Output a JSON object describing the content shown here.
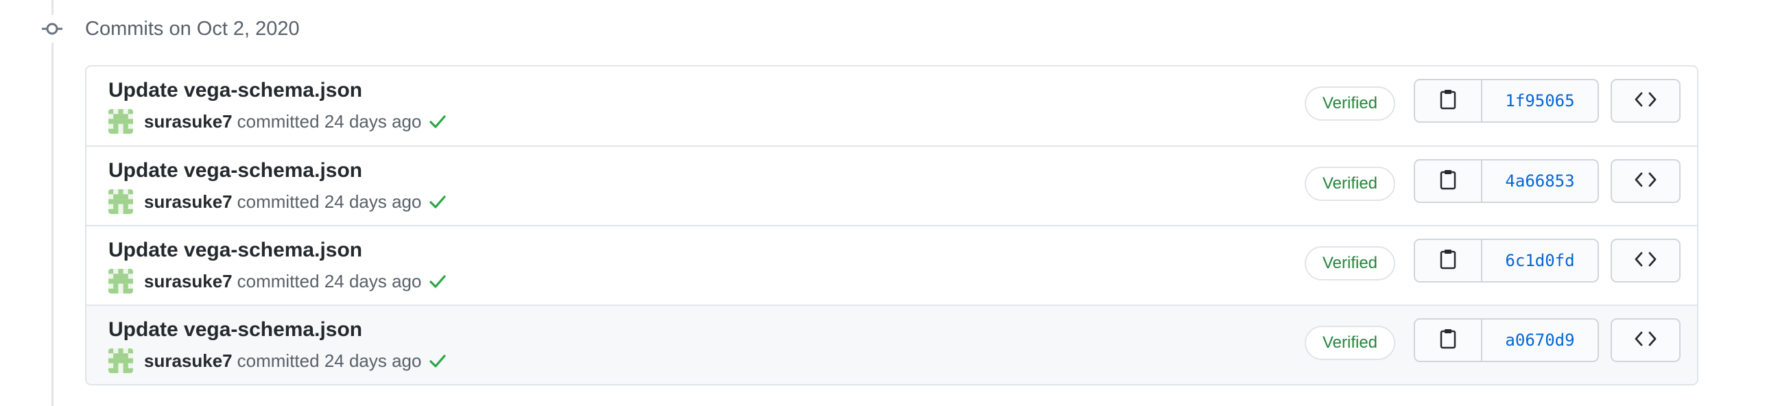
{
  "group": {
    "title": "Commits on Oct 2, 2020"
  },
  "commits": [
    {
      "title": "Update vega-schema.json",
      "author": "surasuke7",
      "action": "committed",
      "time": "24 days ago",
      "badge": "Verified",
      "sha": "1f95065"
    },
    {
      "title": "Update vega-schema.json",
      "author": "surasuke7",
      "action": "committed",
      "time": "24 days ago",
      "badge": "Verified",
      "sha": "4a66853"
    },
    {
      "title": "Update vega-schema.json",
      "author": "surasuke7",
      "action": "committed",
      "time": "24 days ago",
      "badge": "Verified",
      "sha": "6c1d0fd"
    },
    {
      "title": "Update vega-schema.json",
      "author": "surasuke7",
      "action": "committed",
      "time": "24 days ago",
      "badge": "Verified",
      "sha": "a0670d9"
    }
  ],
  "icons": {
    "group": "git-commit-icon",
    "copy": "clipboard-icon",
    "browse": "code-icon",
    "status": "check-icon"
  },
  "colors": {
    "verified": "#22863a",
    "sha_link": "#0366d6",
    "border": "#e1e4e8",
    "hover_row": "#f6f8fa"
  }
}
